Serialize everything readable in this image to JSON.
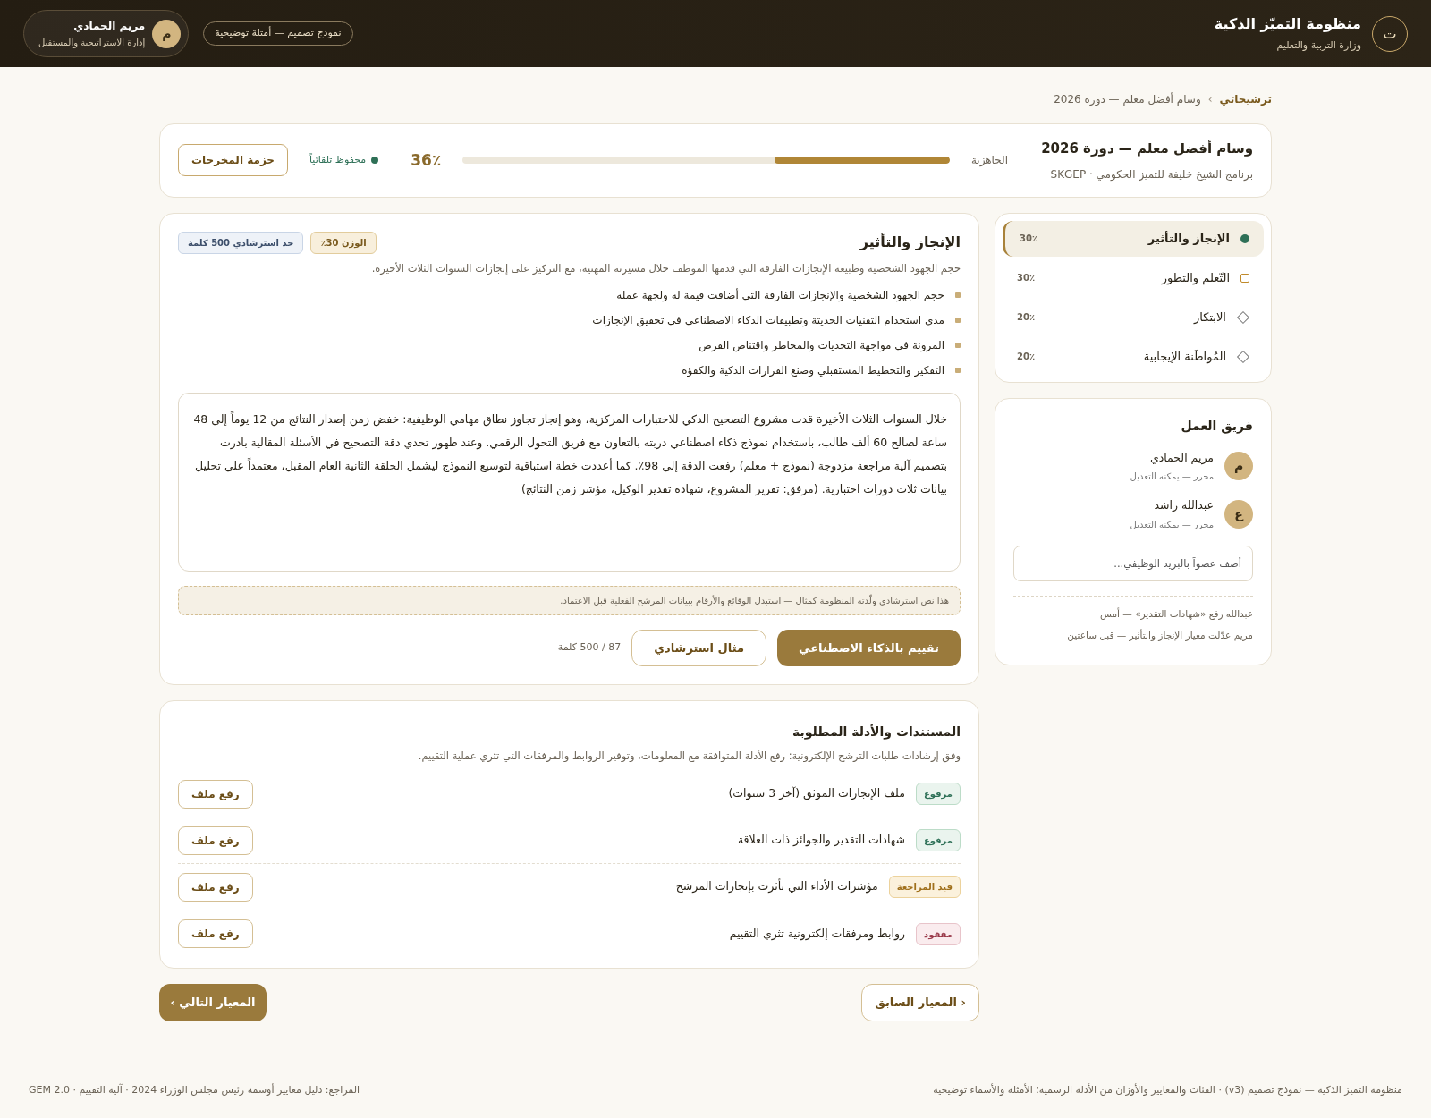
{
  "header": {
    "logo": "ت",
    "title": "منظومة التميّز الذكية",
    "subtitle": "وزارة التربية والتعليم",
    "demo_badge": "نموذج تصميم — أمثلة توضيحية",
    "user": {
      "initial": "م",
      "name": "مريم الحمادي",
      "department": "إدارة الاستراتيجية والمستقبل"
    }
  },
  "breadcrumb": {
    "link": "ترشيحاتي",
    "separator": "›",
    "current": "وسام أفضل معلم — دورة 2026"
  },
  "award": {
    "title": "وسام أفضل معلم — دورة 2026",
    "program": "برنامج الشيخ خليفة للتميز الحكومي · SKGEP",
    "readiness_label": "الجاهزية",
    "level": 0.36,
    "percent": "36٪",
    "saved": "محفوظ تلقائياً",
    "package_button": "حزمة المخرجات"
  },
  "criteria": [
    {
      "label": "الإنجاز والتأثير",
      "weight": "30٪",
      "kind": "current",
      "selected": true
    },
    {
      "label": "التّعلم والتطور",
      "weight": "30٪",
      "kind": "partial",
      "selected": false
    },
    {
      "label": "الابتكار",
      "weight": "20٪",
      "kind": "empty",
      "selected": false
    },
    {
      "label": "المُواطَنة الإيجابية",
      "weight": "20٪",
      "kind": "empty",
      "selected": false
    }
  ],
  "team": {
    "title": "فريق العمل",
    "members": [
      {
        "initial": "م",
        "name": "مريم الحمادي",
        "role": "محرر — يمكنه التعديل"
      },
      {
        "initial": "ع",
        "name": "عبدالله راشد",
        "role": "محرر — يمكنه التعديل"
      }
    ],
    "invite_placeholder": "أضف عضواً بالبريد الوظيفي...",
    "activity": [
      "عبدالله رفع «شهادات التقدير» — أمس",
      "مريم عدّلت معيار الإنجاز والتأثير — قبل ساعتين"
    ]
  },
  "criterion": {
    "title": "الإنجاز والتأثير",
    "weight_badge": "الوزن 30٪",
    "limit_badge": "حد استرشادي 500 كلمة",
    "description": "حجم الجهود الشخصية وطبيعة الإنجازات الفارقة التي قدمها الموظف خلال مسيرته المهنية، مع التركيز على إنجازات السنوات الثلاث الأخيرة.",
    "points": [
      "حجم الجهود الشخصية والإنجازات الفارقة التي أضافت قيمة له ولجهة عمله",
      "مدى استخدام التقنيات الحديثة وتطبيقات الذكاء الاصطناعي في تحقيق الإنجازات",
      "المرونة في مواجهة التحديات والمخاطر واقتناص الفرص",
      "التفكير والتخطيط المستقبلي وصنع القرارات الذكية والكفؤة"
    ],
    "answer": "خلال السنوات الثلاث الأخيرة قدت مشروع التصحيح الذكي للاختبارات المركزية، وهو إنجاز تجاوز نطاق مهامي الوظيفية: خفض زمن إصدار النتائج من 12 يوماً إلى 48 ساعة لصالح 60 ألف طالب، باستخدام نموذج ذكاء اصطناعي دربته بالتعاون مع فريق التحول الرقمي. وعند ظهور تحدي دقة التصحيح في الأسئلة المقالية بادرت بتصميم آلية مراجعة مزدوجة (نموذج + معلم) رفعت الدقة إلى 98٪. كما أعددت خطة استباقية لتوسيع النموذج ليشمل الحلقة الثانية العام المقبل، معتمداً على تحليل بيانات ثلاث دورات اختبارية. (مرفق: تقرير المشروع، شهادة تقدير الوكيل، مؤشر زمن النتائج)",
    "notice": "هذا نص استرشادي ولّدته المنظومة كمثال — استبدل الوقائع والأرقام ببيانات المرشح الفعلية قبل الاعتماد.",
    "ai_button": "تقييم بالذكاء الاصطناعي",
    "example_button": "مثال استرشادي",
    "word_count": "87 / 500 كلمة"
  },
  "evidence": {
    "title": "المستندات والأدلة المطلوبة",
    "description": "وفق إرشادات طلبات الترشح الإلكترونية: رفع الأدلة المتوافقة مع المعلومات، وتوفير الروابط والمرفقات التي تثري عملية التقييم.",
    "items": [
      {
        "kind": "uploaded",
        "badge": "مرفوع",
        "label": "ملف الإنجازات الموثق (آخر 3 سنوات)",
        "button": "رفع ملف"
      },
      {
        "kind": "uploaded",
        "badge": "مرفوع",
        "label": "شهادات التقدير والجوائز ذات العلاقة",
        "button": "رفع ملف"
      },
      {
        "kind": "review",
        "badge": "قيد المراجعة",
        "label": "مؤشرات الأداء التي تأثرت بإنجازات المرشح",
        "button": "رفع ملف"
      },
      {
        "kind": "missing",
        "badge": "مفقود",
        "label": "روابط ومرفقات إلكترونية تثري التقييم",
        "button": "رفع ملف"
      }
    ]
  },
  "nav": {
    "next": "المعيار التالي ›",
    "previous": "‹ المعيار السابق"
  },
  "footer": {
    "right": "منظومة التميز الذكية — نموذج تصميم (v3) · الفئات والمعايير والأوزان من الأدلة الرسمية؛ الأمثلة والأسماء توضيحية",
    "left": "المراجع: دليل معايير أوسمة رئيس مجلس الوزراء 2024 · آلية التقييم · GEM 2.0"
  }
}
